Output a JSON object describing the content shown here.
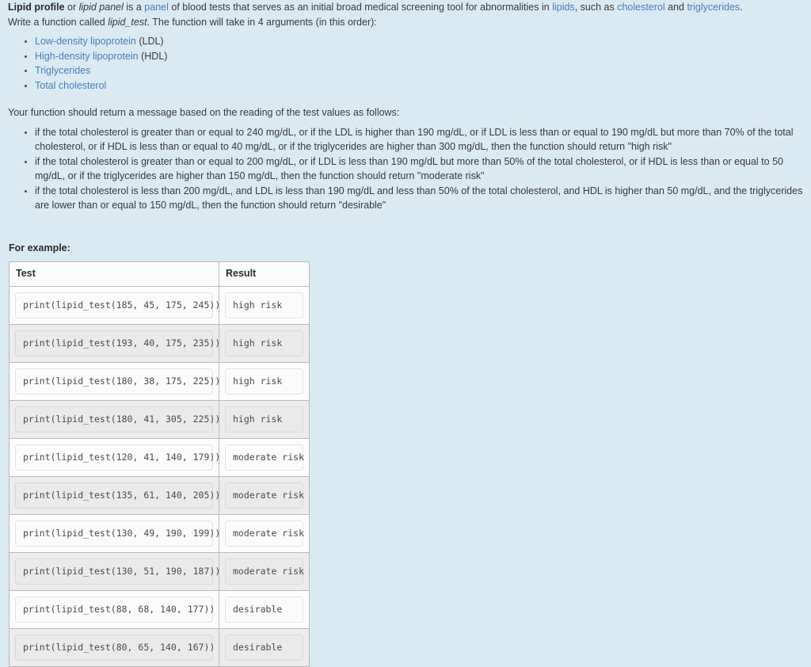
{
  "intro": {
    "line1": {
      "bold_term": "Lipid profile",
      "t1": " or ",
      "italic_term": "lipid panel",
      "t2": " is a ",
      "link_panel": "panel",
      "t3": " of blood tests that serves as an initial broad medical screening tool for abnormalities in ",
      "link_lipids": "lipids",
      "t4": ", such as ",
      "link_cholesterol": "cholesterol",
      "t5": " and ",
      "link_triglycerides": "triglycerides",
      "t6": "."
    },
    "line2": {
      "t1": "Write a function called ",
      "italic_fn": "lipid_test",
      "t2": ". The function will take in 4 arguments (in this order):"
    }
  },
  "arguments": [
    {
      "link": "Low-density lipoprotein",
      "suffix": " (LDL)"
    },
    {
      "link": "High-density lipoprotein",
      "suffix": " (HDL)"
    },
    {
      "link": "Triglycerides",
      "suffix": ""
    },
    {
      "link": "Total cholesterol",
      "suffix": ""
    }
  ],
  "lead_text": "Your function should return a message based on the reading of the test values as follows:",
  "rules": [
    "if the total cholesterol is greater than or equal to 240 mg/dL, or if the LDL is higher than 190 mg/dL, or if LDL is less than or equal to 190 mg/dL but more than 70% of the total cholesterol, or if HDL is less than or equal to 40 mg/dL, or if the triglycerides are higher than 300 mg/dL, then the function should return \"high risk\"",
    "if the total cholesterol is greater than or equal to 200 mg/dL, or if LDL is less than 190 mg/dL but more than 50% of the total cholesterol, or if HDL is less than or equal to 50 mg/dL, or if the triglycerides are higher than 150 mg/dL, then the function should return \"moderate risk\"",
    "if the total cholesterol is less than 200 mg/dL, and LDL is less than 190 mg/dL and less than 50% of the total cholesterol, and HDL is higher than 50 mg/dL, and the triglycerides are lower than or equal to 150 mg/dL, then the function should return \"desirable\""
  ],
  "example_heading": "For example:",
  "table": {
    "headers": {
      "test": "Test",
      "result": "Result"
    },
    "rows": [
      {
        "test": "print(lipid_test(185, 45, 175, 245))",
        "result": "high risk"
      },
      {
        "test": "print(lipid_test(193, 40, 175, 235))",
        "result": "high risk"
      },
      {
        "test": "print(lipid_test(180, 38, 175, 225))",
        "result": "high risk"
      },
      {
        "test": "print(lipid_test(180, 41, 305, 225))",
        "result": "high risk"
      },
      {
        "test": "print(lipid_test(120, 41, 140, 179))",
        "result": "moderate risk"
      },
      {
        "test": "print(lipid_test(135, 61, 140, 205))",
        "result": "moderate risk"
      },
      {
        "test": "print(lipid_test(130, 49, 190, 199))",
        "result": "moderate risk"
      },
      {
        "test": "print(lipid_test(130, 51, 190, 187))",
        "result": "moderate risk"
      },
      {
        "test": "print(lipid_test(88, 68, 140, 177))",
        "result": "desirable"
      },
      {
        "test": "print(lipid_test(80, 65, 140, 167))",
        "result": "desirable"
      }
    ]
  },
  "colors": {
    "page_background": "#d9eaf2",
    "link": "#4a7ebb",
    "body_text": "#3a3a3a",
    "table_border": "#b9b9b9",
    "row_even_background": "#ececec",
    "row_odd_background": "#fdfdfd"
  }
}
